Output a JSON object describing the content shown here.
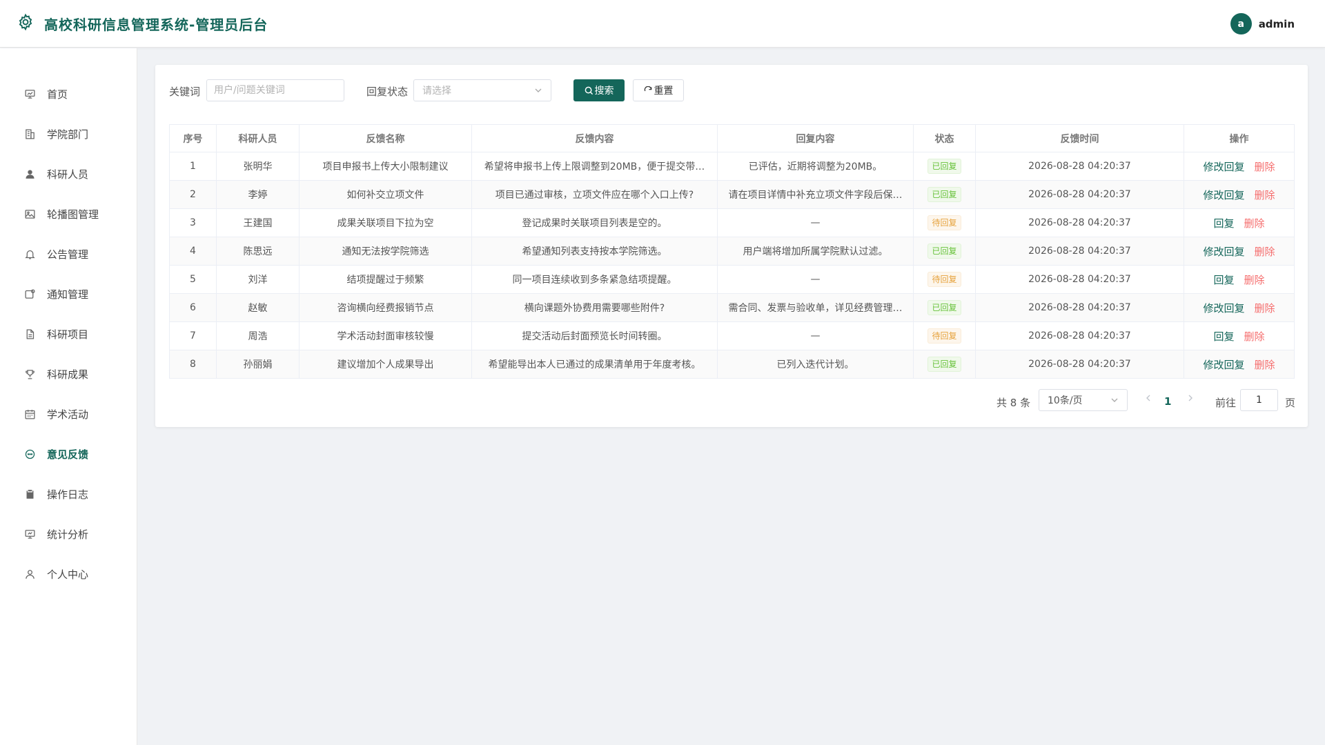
{
  "header": {
    "title": "高校科研信息管理系统-管理员后台",
    "avatar_letter": "a",
    "username": "admin"
  },
  "sidebar": {
    "items": [
      {
        "label": "首页",
        "icon": "dashboard-icon"
      },
      {
        "label": "学院部门",
        "icon": "building-icon"
      },
      {
        "label": "科研人员",
        "icon": "user-icon"
      },
      {
        "label": "轮播图管理",
        "icon": "image-icon"
      },
      {
        "label": "公告管理",
        "icon": "bell-icon"
      },
      {
        "label": "通知管理",
        "icon": "notice-icon"
      },
      {
        "label": "科研项目",
        "icon": "document-icon"
      },
      {
        "label": "科研成果",
        "icon": "trophy-icon"
      },
      {
        "label": "学术活动",
        "icon": "calendar-icon"
      },
      {
        "label": "意见反馈",
        "icon": "chat-icon",
        "active": true
      },
      {
        "label": "操作日志",
        "icon": "clipboard-icon"
      },
      {
        "label": "统计分析",
        "icon": "chart-board-icon"
      },
      {
        "label": "个人中心",
        "icon": "profile-icon"
      }
    ]
  },
  "filters": {
    "keyword_label": "关键词",
    "keyword_placeholder": "用户/问题关键词",
    "status_label": "回复状态",
    "status_placeholder": "请选择",
    "search_label": "搜索",
    "reset_label": "重置"
  },
  "table": {
    "headers": [
      "序号",
      "科研人员",
      "反馈名称",
      "反馈内容",
      "回复内容",
      "状态",
      "反馈时间",
      "操作"
    ],
    "rows": [
      {
        "no": "1",
        "person": "张明华",
        "title": "项目申报书上传大小限制建议",
        "content": "希望将申报书上传上限调整到20MB，便于提交带…",
        "reply": "已评估，近期将调整为20MB。",
        "status": "已回复",
        "status_type": "ok",
        "time": "2026-08-28 04:20:37",
        "edit_label": "修改回复",
        "delete_label": "删除"
      },
      {
        "no": "2",
        "person": "李婷",
        "title": "如何补交立项文件",
        "content": "项目已通过审核，立项文件应在哪个入口上传?",
        "reply": "请在项目详情中补充立项文件字段后保…",
        "status": "已回复",
        "status_type": "ok",
        "time": "2026-08-28 04:20:37",
        "edit_label": "修改回复",
        "delete_label": "删除"
      },
      {
        "no": "3",
        "person": "王建国",
        "title": "成果关联项目下拉为空",
        "content": "登记成果时关联项目列表是空的。",
        "reply": "—",
        "status": "待回复",
        "status_type": "wait",
        "time": "2026-08-28 04:20:37",
        "edit_label": "回复",
        "delete_label": "删除"
      },
      {
        "no": "4",
        "person": "陈思远",
        "title": "通知无法按学院筛选",
        "content": "希望通知列表支持按本学院筛选。",
        "reply": "用户端将增加所属学院默认过滤。",
        "status": "已回复",
        "status_type": "ok",
        "time": "2026-08-28 04:20:37",
        "edit_label": "修改回复",
        "delete_label": "删除"
      },
      {
        "no": "5",
        "person": "刘洋",
        "title": "结项提醒过于频繁",
        "content": "同一项目连续收到多条紧急结项提醒。",
        "reply": "—",
        "status": "待回复",
        "status_type": "wait",
        "time": "2026-08-28 04:20:37",
        "edit_label": "回复",
        "delete_label": "删除"
      },
      {
        "no": "6",
        "person": "赵敏",
        "title": "咨询横向经费报销节点",
        "content": "横向课题外协费用需要哪些附件?",
        "reply": "需合同、发票与验收单，详见经费管理…",
        "status": "已回复",
        "status_type": "ok",
        "time": "2026-08-28 04:20:37",
        "edit_label": "修改回复",
        "delete_label": "删除"
      },
      {
        "no": "7",
        "person": "周浩",
        "title": "学术活动封面审核较慢",
        "content": "提交活动后封面预览长时间转圈。",
        "reply": "—",
        "status": "待回复",
        "status_type": "wait",
        "time": "2026-08-28 04:20:37",
        "edit_label": "回复",
        "delete_label": "删除"
      },
      {
        "no": "8",
        "person": "孙丽娟",
        "title": "建议增加个人成果导出",
        "content": "希望能导出本人已通过的成果清单用于年度考核。",
        "reply": "已列入迭代计划。",
        "status": "已回复",
        "status_type": "ok",
        "time": "2026-08-28 04:20:37",
        "edit_label": "修改回复",
        "delete_label": "删除"
      }
    ]
  },
  "pagination": {
    "total_text": "共 8 条",
    "page_size": "10条/页",
    "current_page": "1",
    "goto_label": "前往",
    "goto_value": "1",
    "page_suffix": "页"
  },
  "colors": {
    "accent": "#14665a",
    "success": "#67c23a",
    "warning": "#e6a23c",
    "danger": "#f56c6c"
  }
}
